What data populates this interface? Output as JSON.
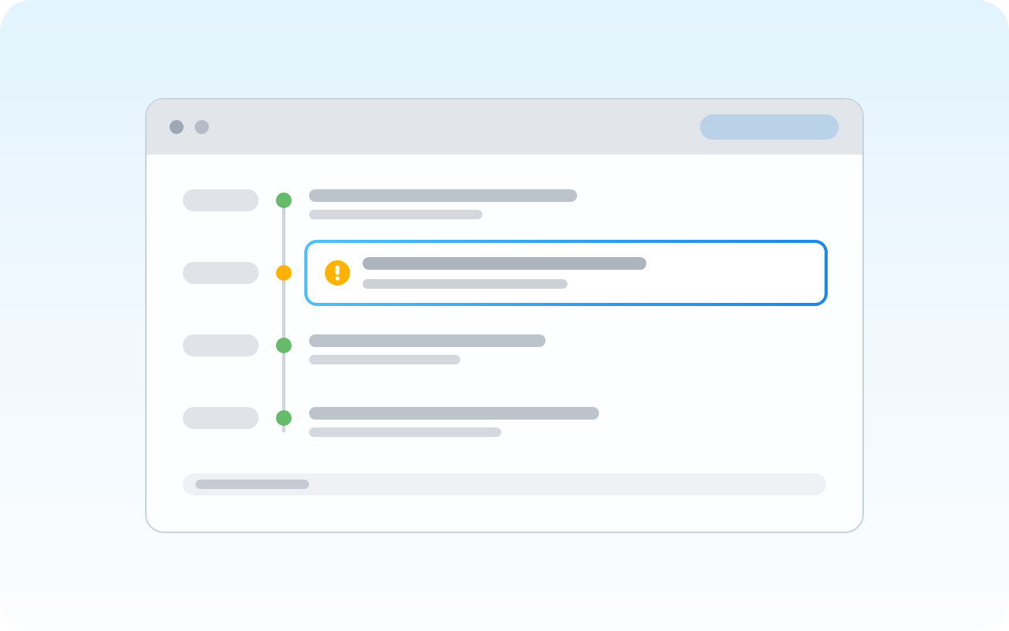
{
  "timeline": {
    "events": [
      {
        "kind": "done",
        "color": "#66bb6a",
        "selected": false
      },
      {
        "kind": "warning",
        "color": "#ffb300",
        "selected": true
      },
      {
        "kind": "done",
        "color": "#66bb6a",
        "selected": false
      },
      {
        "kind": "done",
        "color": "#66bb6a",
        "selected": false
      }
    ]
  }
}
